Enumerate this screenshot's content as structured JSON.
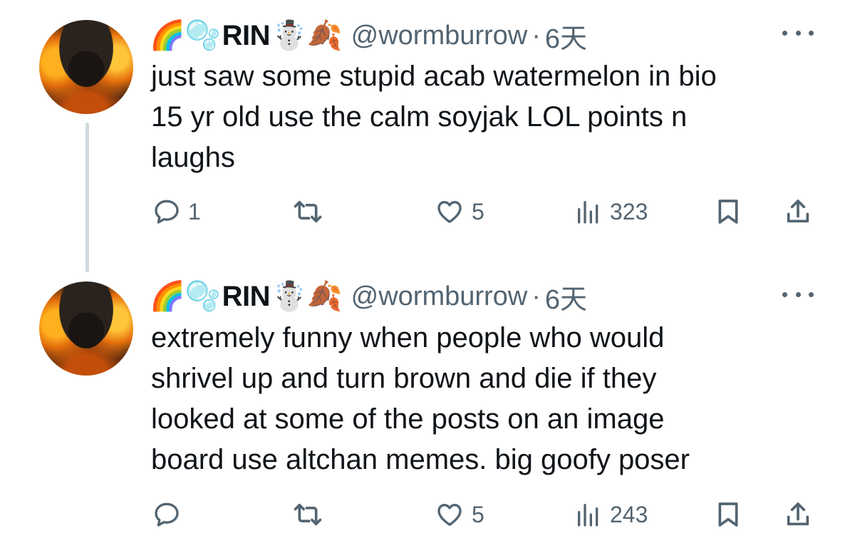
{
  "tweets": [
    {
      "author": {
        "name": "RIN",
        "handle": "@wormburrow",
        "name_emoji_before": [
          "🌈",
          "🫧"
        ],
        "name_emoji_after": [
          "☃️",
          "🍂"
        ]
      },
      "separator": "·",
      "time": "6天",
      "text": "just saw some stupid acab watermelon in bio\n15 yr old use the calm soyjak LOL points n\nlaughs",
      "stats": {
        "replies": "1",
        "retweets": "",
        "likes": "5",
        "views": "323"
      },
      "icons": [
        "reply-icon",
        "retweet-icon",
        "like-icon",
        "views-icon",
        "bookmark-icon",
        "share-icon",
        "more-icon"
      ]
    },
    {
      "author": {
        "name": "RIN",
        "handle": "@wormburrow",
        "name_emoji_before": [
          "🌈",
          "🫧"
        ],
        "name_emoji_after": [
          "☃️",
          "🍂"
        ]
      },
      "separator": "·",
      "time": "6天",
      "text": "extremely funny when people who would\nshrivel up and turn brown and die if they\nlooked at some of the posts on an image\nboard use altchan memes. big goofy poser",
      "stats": {
        "replies": "",
        "retweets": "",
        "likes": "5",
        "views": "243"
      },
      "icons": [
        "reply-icon",
        "retweet-icon",
        "like-icon",
        "views-icon",
        "bookmark-icon",
        "share-icon",
        "more-icon"
      ]
    }
  ],
  "colors": {
    "text": "#0f1419",
    "secondary": "#536471",
    "thread_line": "#cfd9de",
    "background": "#ffffff"
  }
}
